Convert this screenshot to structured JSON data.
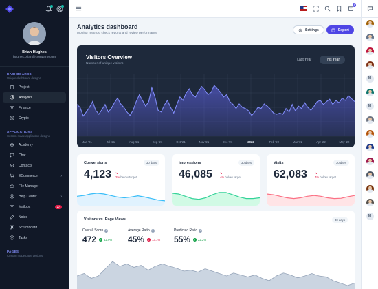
{
  "user": {
    "name": "Brian Hughes",
    "email": "hughes.brian@company.com"
  },
  "sidebar": {
    "groups": [
      {
        "title": "DASHBOARDS",
        "subtitle": "Unique dashboard designs",
        "items": [
          {
            "label": "Project",
            "icon": "clipboard-icon"
          },
          {
            "label": "Analytics",
            "icon": "chart-pie-icon",
            "active": true
          },
          {
            "label": "Finance",
            "icon": "cash-icon"
          },
          {
            "label": "Crypto",
            "icon": "currency-icon"
          }
        ]
      },
      {
        "title": "APPLICATIONS",
        "subtitle": "Custom made application designs",
        "items": [
          {
            "label": "Academy",
            "icon": "academic-cap-icon"
          },
          {
            "label": "Chat",
            "icon": "chat-icon"
          },
          {
            "label": "Contacts",
            "icon": "users-icon"
          },
          {
            "label": "ECommerce",
            "icon": "cart-icon",
            "chevron": "›"
          },
          {
            "label": "File Manager",
            "icon": "cloud-icon"
          },
          {
            "label": "Help Center",
            "icon": "support-icon",
            "chevron": "›"
          },
          {
            "label": "Mailbox",
            "icon": "mail-icon",
            "badge": "27"
          },
          {
            "label": "Notes",
            "icon": "pencil-icon"
          },
          {
            "label": "Scrumboard",
            "icon": "view-boards-icon"
          },
          {
            "label": "Tasks",
            "icon": "check-circle-icon"
          }
        ]
      },
      {
        "title": "PAGES",
        "subtitle": "Custom made page designs",
        "items": []
      }
    ]
  },
  "topbar": {
    "cart_count": "4"
  },
  "header": {
    "title": "Analytics dashboard",
    "subtitle": "Monitor metrics, check reports and review performance",
    "settings_label": "Settings",
    "export_label": "Export"
  },
  "visitors": {
    "title": "Visitors Overview",
    "subtitle": "Number of unique visitors",
    "tab_last": "Last Year",
    "tab_this": "This Year"
  },
  "cards": [
    {
      "title": "Conversions",
      "period": "30 days",
      "value": "4,123",
      "change": "2%",
      "note": "below target",
      "color": "#38bdf8",
      "fill": "#e0f2fe"
    },
    {
      "title": "Impressions",
      "period": "30 days",
      "value": "46,085",
      "change": "4%",
      "note": "below target",
      "color": "#34d399",
      "fill": "#d1fae5"
    },
    {
      "title": "Visits",
      "period": "30 days",
      "value": "62,083",
      "change": "4%",
      "note": "below target",
      "color": "#fb7185",
      "fill": "#ffe4e6"
    }
  ],
  "vpv": {
    "title": "Visitors vs. Page Views",
    "period": "30 days",
    "stats": [
      {
        "label": "Overall Score",
        "value": "472",
        "change": "42.9%",
        "dir": "up"
      },
      {
        "label": "Average Ratio",
        "value": "45%",
        "change": "13.1%",
        "dir": "down"
      },
      {
        "label": "Predicted Ratio",
        "value": "55%",
        "change": "22.2%",
        "dir": "up"
      }
    ]
  },
  "rail": {
    "avatars": [
      "#a16207",
      "#64748b",
      "#be123c",
      "#7c2d12",
      "M",
      "#0f766e",
      "M",
      "#6b7280",
      "#b45309",
      "#1e3a8a",
      "#9d174d",
      "#4b5563",
      "#78350f",
      "#57534e",
      "M"
    ]
  },
  "chart_data": [
    {
      "type": "area",
      "title": "Visitors Overview",
      "x": [
        "Jan '21",
        "Jul '21",
        "Aug '21",
        "Sep '21",
        "Oct '21",
        "Nov '21",
        "Dec '21",
        "2022",
        "Feb '22",
        "Mar '22",
        "Apr '22",
        "May '22"
      ],
      "y_relative": [
        0.55,
        0.5,
        0.35,
        0.42,
        0.5,
        0.6,
        0.45,
        0.38,
        0.46,
        0.55,
        0.42,
        0.48,
        0.58,
        0.66,
        0.56,
        0.5,
        0.42,
        0.36,
        0.45,
        0.6,
        0.72,
        0.62,
        0.52,
        0.6,
        0.84,
        0.68,
        0.45,
        0.42,
        0.54,
        0.62,
        0.5,
        0.4,
        0.55,
        0.68,
        0.62,
        0.75,
        0.82,
        0.72,
        0.68,
        0.78,
        0.86,
        0.8,
        0.72,
        0.76,
        0.88,
        0.82,
        0.76,
        0.68,
        0.72,
        0.6,
        0.55,
        0.48,
        0.56,
        0.5,
        0.48,
        0.44,
        0.36,
        0.42,
        0.5,
        0.48,
        0.56,
        0.52,
        0.47,
        0.4,
        0.38,
        0.4,
        0.38,
        0.48,
        0.42,
        0.55,
        0.44,
        0.52,
        0.48,
        0.58,
        0.5,
        0.45,
        0.52,
        0.6,
        0.62,
        0.55,
        0.6,
        0.64,
        0.55,
        0.62,
        0.58,
        0.66,
        0.62,
        0.7,
        0.65,
        0.6
      ],
      "x_tick_bold": "2022"
    },
    {
      "type": "area",
      "title": "Conversions",
      "y_relative": [
        0.35,
        0.4,
        0.5,
        0.55,
        0.5,
        0.4,
        0.3,
        0.25,
        0.3,
        0.38,
        0.3,
        0.2,
        0.1,
        0.05
      ]
    },
    {
      "type": "area",
      "title": "Impressions",
      "y_relative": [
        0.55,
        0.5,
        0.35,
        0.2,
        0.15,
        0.25,
        0.45,
        0.6,
        0.6,
        0.45,
        0.3,
        0.2,
        0.2,
        0.25
      ]
    },
    {
      "type": "area",
      "title": "Visits",
      "y_relative": [
        0.5,
        0.45,
        0.35,
        0.25,
        0.2,
        0.25,
        0.35,
        0.4,
        0.35,
        0.25,
        0.2,
        0.22,
        0.32,
        0.4
      ]
    },
    {
      "type": "area",
      "title": "Visitors vs. Page Views",
      "y_relative": [
        0.5,
        0.55,
        0.45,
        0.5,
        0.65,
        0.8,
        0.7,
        0.75,
        0.68,
        0.72,
        0.62,
        0.7,
        0.75,
        0.7,
        0.66,
        0.6,
        0.62,
        0.58,
        0.65,
        0.6,
        0.55,
        0.5,
        0.56,
        0.52,
        0.48,
        0.52,
        0.45,
        0.4,
        0.5,
        0.56,
        0.52,
        0.46,
        0.5,
        0.55,
        0.5,
        0.48,
        0.4,
        0.35,
        0.3,
        0.35
      ]
    }
  ]
}
